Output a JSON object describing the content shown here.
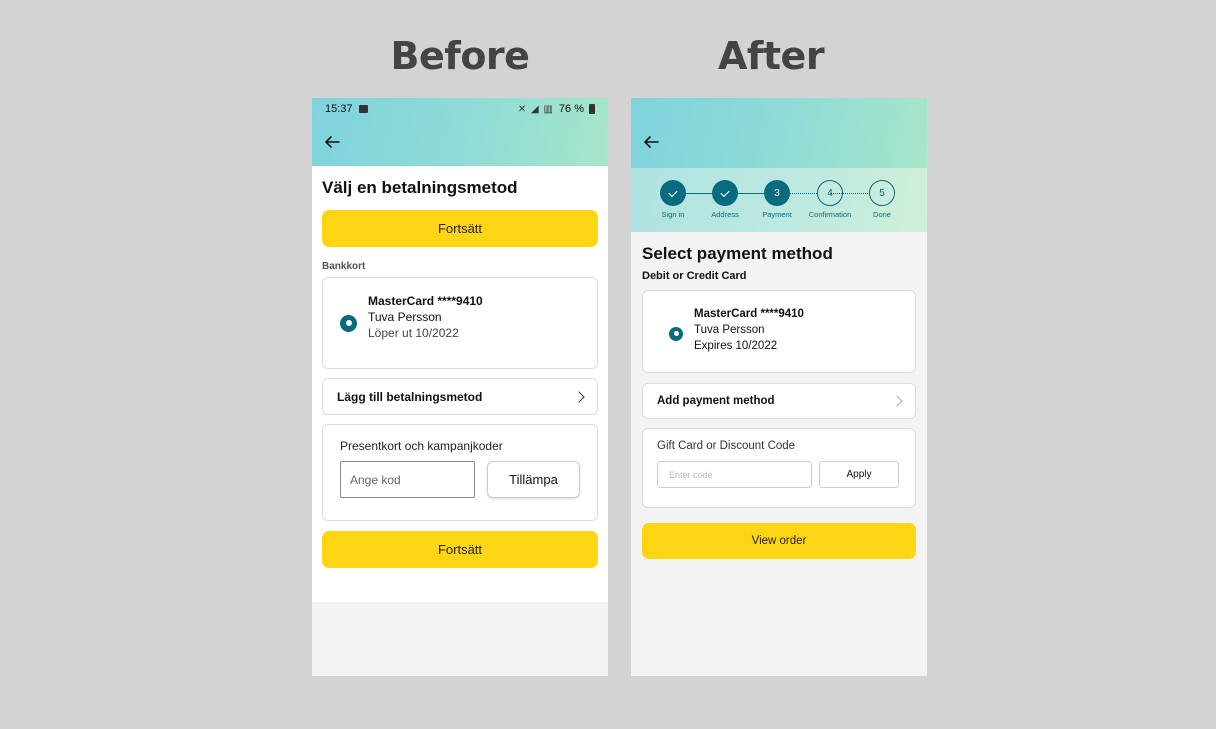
{
  "headings": {
    "before": "Before",
    "after": "After"
  },
  "before": {
    "status": {
      "time": "15:37",
      "battery": "76 %"
    },
    "title": "Välj en betalningsmetod",
    "continue_label": "Fortsätt",
    "section_label": "Bankkort",
    "card": {
      "name": "MasterCard  ****9410",
      "holder": "Tuva Persson",
      "expiry": "Löper ut 10/2022"
    },
    "add_payment_label": "Lägg till betalningsmetod",
    "gift": {
      "label": "Presentkort och kampanjkoder",
      "placeholder": "Ange kod",
      "apply_label": "Tillämpa"
    },
    "continue_label_2": "Fortsätt"
  },
  "after": {
    "steps": [
      {
        "number": "1",
        "label": "Sign in",
        "state": "done"
      },
      {
        "number": "2",
        "label": "Address",
        "state": "done"
      },
      {
        "number": "3",
        "label": "Payment",
        "state": "current"
      },
      {
        "number": "4",
        "label": "Confirmation",
        "state": "todo"
      },
      {
        "number": "5",
        "label": "Done",
        "state": "todo"
      }
    ],
    "title": "Select payment method",
    "section_label": "Debit or Credit Card",
    "card": {
      "name": "MasterCard ****9410",
      "holder": "Tuva Persson",
      "expiry": "Expires 10/2022"
    },
    "add_payment_label": "Add payment method",
    "gift": {
      "label": "Gift Card or Discount Code",
      "placeholder": "Enter code",
      "apply_label": "Apply"
    },
    "view_order_label": "View order"
  },
  "colors": {
    "accent": "#0a6a80",
    "button_yellow": "#ffd514",
    "background": "#d3d3d3"
  }
}
